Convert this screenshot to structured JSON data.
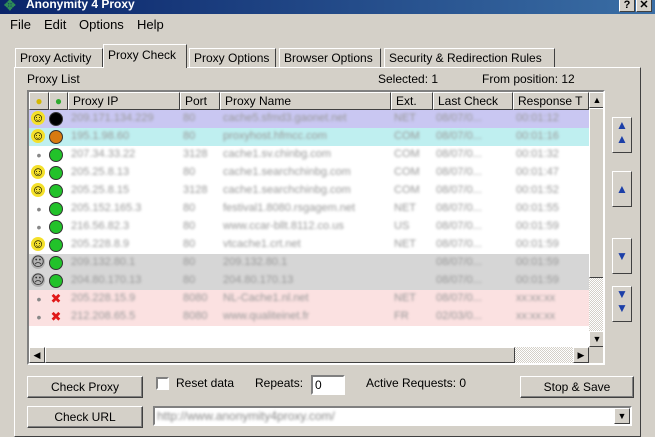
{
  "window": {
    "title": "Anonymity 4 Proxy"
  },
  "menu": {
    "file": "File",
    "edit": "Edit",
    "options": "Options",
    "help": "Help"
  },
  "tabs": [
    {
      "label": "Proxy Activity"
    },
    {
      "label": "Proxy Check"
    },
    {
      "label": "Proxy Options"
    },
    {
      "label": "Browser Options"
    },
    {
      "label": "Security & Redirection Rules"
    }
  ],
  "proxy_list": {
    "label": "Proxy List",
    "selected_label": "Selected: 1",
    "from_position_label": "From position: 12",
    "columns": [
      "Proxy IP",
      "Port",
      "Proxy Name",
      "Ext.",
      "Last Check",
      "Response T"
    ],
    "rows": [
      {
        "ip": "209.171.134.229",
        "port": "80",
        "name": "cache5.sfmd3.gaonet.net",
        "ext": "NET",
        "last": "08/07/0...",
        "resp": "00:01:12",
        "status1": "smile",
        "status2": "black",
        "bg": "#c9c7f2"
      },
      {
        "ip": "195.1.98.60",
        "port": "80",
        "name": "proxyhost.hfmcc.com",
        "ext": "COM",
        "last": "08/07/0...",
        "resp": "00:01:16",
        "status1": "smile",
        "status2": "orange",
        "bg": "#bfeff0"
      },
      {
        "ip": "207.34.33.22",
        "port": "3128",
        "name": "cache1.sv.chinbg.com",
        "ext": "COM",
        "last": "08/07/0...",
        "resp": "00:01:32",
        "status1": "dot",
        "status2": "green",
        "bg": "#ffffff"
      },
      {
        "ip": "205.25.8.13",
        "port": "80",
        "name": "cache1.searchchinbg.com",
        "ext": "COM",
        "last": "08/07/0...",
        "resp": "00:01:47",
        "status1": "smile",
        "status2": "green",
        "bg": "#ffffff"
      },
      {
        "ip": "205.25.8.15",
        "port": "3128",
        "name": "cache1.searchchinbg.com",
        "ext": "COM",
        "last": "08/07/0...",
        "resp": "00:01:52",
        "status1": "smile",
        "status2": "green",
        "bg": "#ffffff"
      },
      {
        "ip": "205.152.165.3",
        "port": "80",
        "name": "festival1.8080.rsgagem.net",
        "ext": "NET",
        "last": "08/07/0...",
        "resp": "00:01:55",
        "status1": "dot",
        "status2": "green",
        "bg": "#ffffff"
      },
      {
        "ip": "216.56.82.3",
        "port": "80",
        "name": "www.ccar-bllt.8112.co.us",
        "ext": "US",
        "last": "08/07/0...",
        "resp": "00:01:59",
        "status1": "dot",
        "status2": "green",
        "bg": "#ffffff"
      },
      {
        "ip": "205.228.8.9",
        "port": "80",
        "name": "vtcache1.crt.net",
        "ext": "NET",
        "last": "08/07/0...",
        "resp": "00:01:59",
        "status1": "smile",
        "status2": "green",
        "bg": "#ffffff"
      },
      {
        "ip": "209.132.80.1",
        "port": "80",
        "name": "209.132.80.1",
        "ext": "",
        "last": "08/07/0...",
        "resp": "00:01:59",
        "status1": "grey",
        "status2": "green",
        "bg": "#d6d6d6"
      },
      {
        "ip": "204.80.170.13",
        "port": "80",
        "name": "204.80.170.13",
        "ext": "",
        "last": "08/07/0...",
        "resp": "00:01:59",
        "status1": "grey",
        "status2": "green",
        "bg": "#d6d6d6"
      },
      {
        "ip": "205.228.15.9",
        "port": "8080",
        "name": "NL-Cache1.nl.net",
        "ext": "NET",
        "last": "08/07/0...",
        "resp": "xx:xx:xx",
        "status1": "dot",
        "status2": "x",
        "bg": "#fbe1e1"
      },
      {
        "ip": "212.208.65.5",
        "port": "8080",
        "name": "www.qualiteinet.fr",
        "ext": "FR",
        "last": "02/03/0...",
        "resp": "xx:xx:xx",
        "status1": "dot",
        "status2": "x",
        "bg": "#fbe1e1"
      }
    ]
  },
  "controls": {
    "check_proxy": "Check Proxy",
    "reset_data": "Reset data",
    "repeats_label": "Repeats:",
    "repeats_value": "0",
    "active_requests": "Active Requests: 0",
    "stop_save": "Stop & Save",
    "check_url": "Check URL",
    "url_value": "http://www.anonymity4proxy.com/"
  },
  "colors": {
    "title_start": "#0a246a",
    "title_end": "#3a6ea5",
    "nav_arrow": "#1c3fa8"
  }
}
